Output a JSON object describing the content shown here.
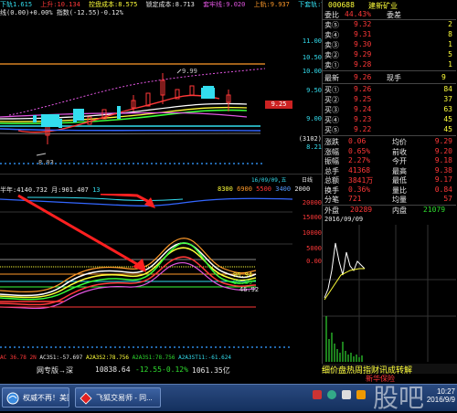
{
  "header_line1": {
    "a": "下轨1.615",
    "b": "上升:10.134",
    "c": "控盘成本:8.575",
    "d": "锁定成本:8.713",
    "e": "套牢线:9.020",
    "f": "上轨:9.937",
    "g": "下套轨:T"
  },
  "header_line2": {
    "a": "线(0.00)+0.00% 指数(-12.55)-0.12%"
  },
  "price_axis": [
    "11.00",
    "10.50",
    "10.00",
    "9.50",
    "9.00",
    "8.21",
    "9.25"
  ],
  "price_axis_badge": "(3102)",
  "kline_labels": {
    "high": "9.99",
    "low": "8.03"
  },
  "indicator_header": {
    "a": "半年:4140.732",
    "b": "月:901.407",
    "c": "13"
  },
  "indicator_axis_top": [
    "16/09/09,五",
    "日线"
  ],
  "indicator_scale": [
    "8300",
    "6900",
    "5500",
    "3400",
    "2000"
  ],
  "indicator_axis": [
    "20000",
    "15000",
    "10000",
    "5000",
    "0.00"
  ],
  "indicator_labels": {
    "upper": "96.94",
    "mid": "80.89",
    "lower": "46.92"
  },
  "bottom_indicator_line": {
    "a": "AC 36.78 2N",
    "b": "AC3S1:-57.697",
    "c": "A2A3S2:78.756",
    "d": "A2A3S1:78.756",
    "e": "A2A3ST11:-61.624"
  },
  "orderbook": {
    "code": "000688",
    "name": "建新矿业",
    "ratio_label": "委比",
    "ratio_value": "44.43%",
    "diff_label": "委差",
    "diff_value": "",
    "sells": [
      {
        "label": "卖⑤",
        "price": "9.32",
        "vol": "2"
      },
      {
        "label": "卖④",
        "price": "9.31",
        "vol": "8"
      },
      {
        "label": "卖③",
        "price": "9.30",
        "vol": "1"
      },
      {
        "label": "卖②",
        "price": "9.29",
        "vol": "5"
      },
      {
        "label": "卖①",
        "price": "9.28",
        "vol": "1"
      }
    ],
    "last_label": "最新",
    "last_price": "9.26",
    "last_hand_label": "现手",
    "last_hand": "9",
    "buys": [
      {
        "label": "买①",
        "price": "9.26",
        "vol": "84"
      },
      {
        "label": "买②",
        "price": "9.25",
        "vol": "37"
      },
      {
        "label": "买③",
        "price": "9.24",
        "vol": "63"
      },
      {
        "label": "买④",
        "price": "9.23",
        "vol": "45"
      },
      {
        "label": "买⑤",
        "price": "9.22",
        "vol": "45"
      }
    ],
    "stats": [
      {
        "l1": "涨跌",
        "v1": "0.06",
        "l2": "均价",
        "v2": "9.29"
      },
      {
        "l1": "涨幅",
        "v1": "0.65%",
        "l2": "前收",
        "v2": "9.20"
      },
      {
        "l1": "振幅",
        "v1": "2.27%",
        "l2": "今开",
        "v2": "9.18"
      },
      {
        "l1": "总手",
        "v1": "41368",
        "l2": "最高",
        "v2": "9.38"
      },
      {
        "l1": "总额",
        "v1": "3841万",
        "l2": "最低",
        "v2": "9.17"
      },
      {
        "l1": "换手",
        "v1": "0.36%",
        "l2": "量比",
        "v2": "0.84"
      },
      {
        "l1": "分笔",
        "v1": "721",
        "l2": "均量",
        "v2": "57"
      }
    ],
    "outer_label": "外盘",
    "outer_value": "20289",
    "inner_label": "内盘",
    "inner_value": "21079",
    "mini_date": "2016/09/09"
  },
  "ticker": {
    "label": "网专版→深",
    "index": "10838.64",
    "change": "-12.55",
    "pct": "-0.12%",
    "amount": "1061.35亿"
  },
  "news": {
    "line1": "细价盘热周指财讯成转解",
    "line2": "新华保险"
  },
  "taskbar": {
    "task1": "权威不再！美国...",
    "task2": "飞狐交易师 - 同...",
    "clock_time": "10:27",
    "clock_date": "2016/9/9"
  },
  "watermark": "股吧"
}
